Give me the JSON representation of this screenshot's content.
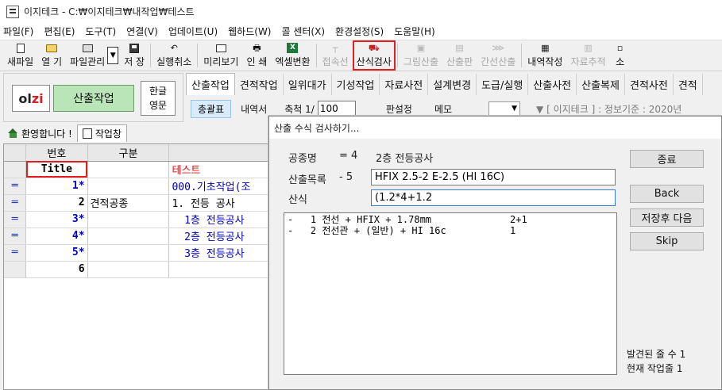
{
  "window": {
    "title": "이지테크 - C:₩이지테크₩내작업₩테스트"
  },
  "menu": [
    "파일(F)",
    "편집(E)",
    "도구(T)",
    "연결(V)",
    "업데이트(U)",
    "웹하드(W)",
    "콜 센터(X)",
    "환경설정(S)",
    "도움말(H)"
  ],
  "toolbar": {
    "items": [
      {
        "label": "새파일",
        "icon": "new-file-icon",
        "enabled": true
      },
      {
        "label": "열 기",
        "icon": "open-folder-icon",
        "enabled": true
      },
      {
        "label": "파일관리",
        "icon": "file-manager-icon",
        "enabled": true
      },
      {
        "label": "저 장",
        "icon": "save-icon",
        "enabled": true
      },
      {
        "label": "실행취소",
        "icon": "undo-icon",
        "enabled": true
      },
      {
        "label": "미리보기",
        "icon": "preview-icon",
        "enabled": true
      },
      {
        "label": "인 쇄",
        "icon": "print-icon",
        "enabled": true
      },
      {
        "label": "엑셀변환",
        "icon": "excel-icon",
        "enabled": true
      },
      {
        "label": "접속선",
        "icon": "connect-line-icon",
        "enabled": false
      },
      {
        "label": "산식검사",
        "icon": "formula-check-icon",
        "enabled": true,
        "highlighted": true
      },
      {
        "label": "그림산출",
        "icon": "picture-calc-icon",
        "enabled": false
      },
      {
        "label": "산출판",
        "icon": "calc-board-icon",
        "enabled": false
      },
      {
        "label": "간선산출",
        "icon": "trunk-calc-icon",
        "enabled": false
      },
      {
        "label": "내역작성",
        "icon": "statement-icon",
        "enabled": true
      },
      {
        "label": "자료추적",
        "icon": "data-trace-icon",
        "enabled": false
      },
      {
        "label": "소",
        "icon": "more-icon",
        "enabled": true
      }
    ]
  },
  "left_panel": {
    "logo_text_1": "ol",
    "logo_text_2": "zi",
    "calc_button": "산출작업",
    "lang_1": "한글",
    "lang_2": "영문"
  },
  "tabs": [
    "산출작업",
    "견적작업",
    "일위대가",
    "기성작업",
    "자료사전",
    "설계변경",
    "도급/실행",
    "산출사전",
    "산출복제",
    "견적사전",
    "견적"
  ],
  "subrow": {
    "totals": "총괄표",
    "statement": "내역서",
    "scale_label": "축척 1/",
    "scale_value": "100",
    "plate": "판설정",
    "memo": "메모",
    "combo_arrow": "▼",
    "info_arrow": "▼",
    "info": "[ 이지테크 ] : 정보기준 : 2020년 "
  },
  "work_tabs": {
    "welcome": "환영합니다 !",
    "workwindow": "작업창"
  },
  "grid": {
    "headers": [
      "번호",
      "구분",
      ""
    ],
    "rows": [
      {
        "marker": "",
        "num": "Title",
        "div": "",
        "text": "테스트",
        "text_color": "red",
        "num_style": "title"
      },
      {
        "marker": "═",
        "num": "1*",
        "div": "",
        "text": "000.기초작업(조",
        "text_color": "blue",
        "num_style": "blue"
      },
      {
        "marker": "═",
        "num": "2",
        "div": "견적공종",
        "text": "1. 전등 공사",
        "text_color": "black",
        "num_style": "plain"
      },
      {
        "marker": "═",
        "num": "3*",
        "div": "",
        "text": "  1층 전등공사",
        "text_color": "blue",
        "num_style": "blue"
      },
      {
        "marker": "═",
        "num": "4*",
        "div": "",
        "text": "  2층 전등공사",
        "text_color": "blue",
        "num_style": "blue"
      },
      {
        "marker": "═",
        "num": "5*",
        "div": "",
        "text": "  3층 전등공사",
        "text_color": "blue",
        "num_style": "blue"
      },
      {
        "marker": "",
        "num": "6",
        "div": "",
        "text": "",
        "text_color": "black",
        "num_style": "plain"
      }
    ]
  },
  "dialog": {
    "title": "산출 수식 검사하기...",
    "work_type_label": "공종명",
    "work_type_num": "= 4",
    "work_type_value": "2층 전등공사",
    "item_label": "산출목록",
    "item_num": "- 5",
    "item_value": "HFIX 2.5-2 E-2.5 (HI 16C)",
    "formula_label": "산식",
    "formula_value": "(1.2*4+1.2",
    "list": [
      {
        "left": "-   1 전선 + HFIX + 1.78mm",
        "right": "2+1"
      },
      {
        "left": "-   2 전선관 + (일반) + HI 16c",
        "right": "1"
      }
    ],
    "buttons": {
      "close": "종료",
      "back": "Back",
      "save_next": "저장후 다음",
      "skip": "Skip"
    },
    "found_lines": "발견된 줄 수 1",
    "current_line": "현재 작업줄 1"
  },
  "colors": {
    "highlight": "#e02020",
    "calc_button": "#b9e5b9",
    "blue_text": "#0000c0",
    "red_text": "#e01010"
  }
}
